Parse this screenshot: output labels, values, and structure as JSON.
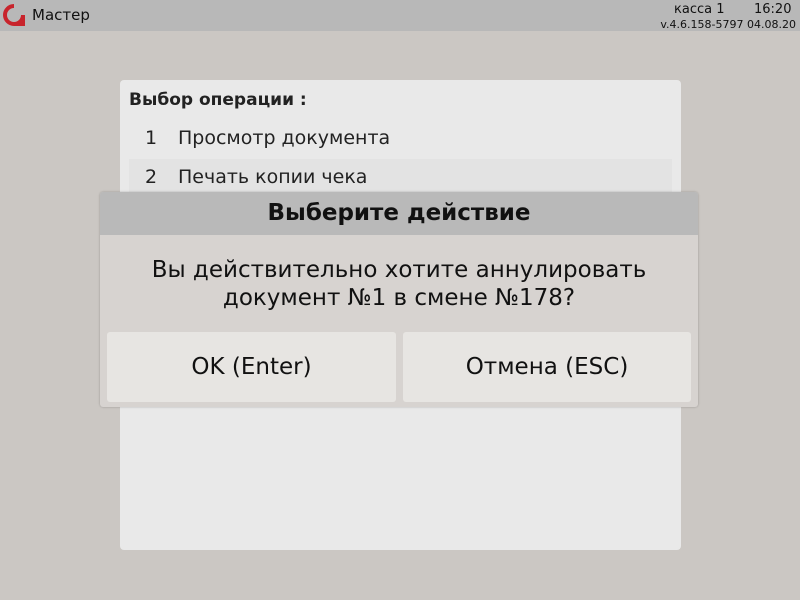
{
  "topbar": {
    "app_title": "Мастер",
    "register": "касса 1",
    "time": "16:20",
    "version": "v.4.6.158-5797  04.08.20",
    "logo_color": "#c8242c"
  },
  "panel": {
    "title": "Выбор операции :",
    "items": [
      {
        "num": "1",
        "label": "Просмотр документа"
      },
      {
        "num": "2",
        "label": "Печать копии чека"
      }
    ]
  },
  "dialog": {
    "title": "Выберите действие",
    "message_line1": "Вы действительно хотите аннулировать",
    "message_line2": "документ №1 в смене №178?",
    "ok_label": "OK (Enter)",
    "cancel_label": "Отмена (ESC)"
  }
}
